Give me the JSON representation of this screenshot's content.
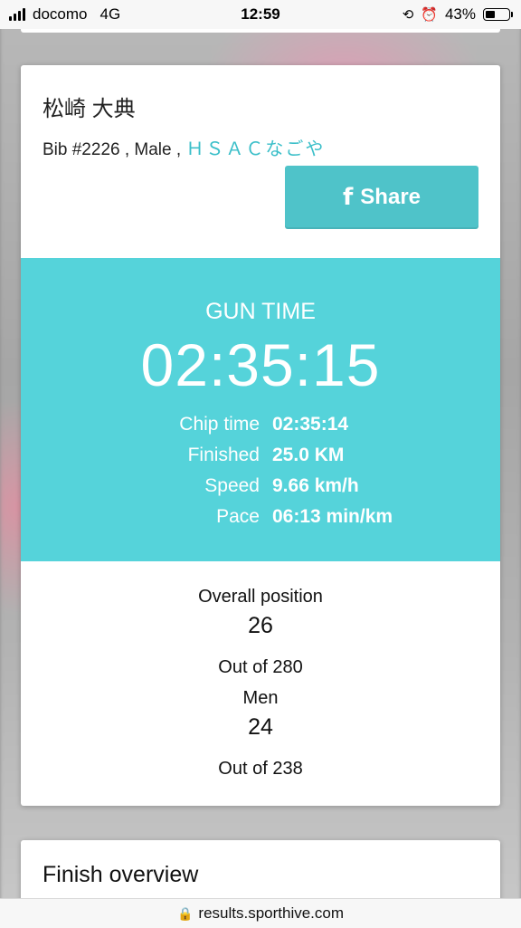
{
  "status_bar": {
    "carrier": "docomo",
    "network": "4G",
    "time": "12:59",
    "battery": "43%",
    "battery_level": 0.43
  },
  "athlete": {
    "name": "松崎 大典",
    "bib_gender": "Bib #2226 , Male , ",
    "club": "ＨＳＡＣなごや"
  },
  "share_button": {
    "icon": "facebook-icon",
    "label": "Share"
  },
  "results": {
    "gun_label": "GUN TIME",
    "gun_time": "02:35:15",
    "stats": [
      {
        "label": "Chip time",
        "value": "02:35:14"
      },
      {
        "label": "Finished",
        "value": "25.0 KM"
      },
      {
        "label": "Speed",
        "value": "9.66 km/h"
      },
      {
        "label": "Pace",
        "value": "06:13 min/km"
      }
    ]
  },
  "positions": {
    "overall_label": "Overall position",
    "overall_value": "26",
    "overall_out_of": "Out of 280",
    "category_label": "Men",
    "category_value": "24",
    "category_out_of": "Out of 238"
  },
  "finish_overview": {
    "title": "Finish overview"
  },
  "url_bar": {
    "url": "results.sporthive.com"
  },
  "colors": {
    "accent": "#55d3da",
    "share_button": "#4fc3c9",
    "club_text": "#3bbfc9"
  }
}
